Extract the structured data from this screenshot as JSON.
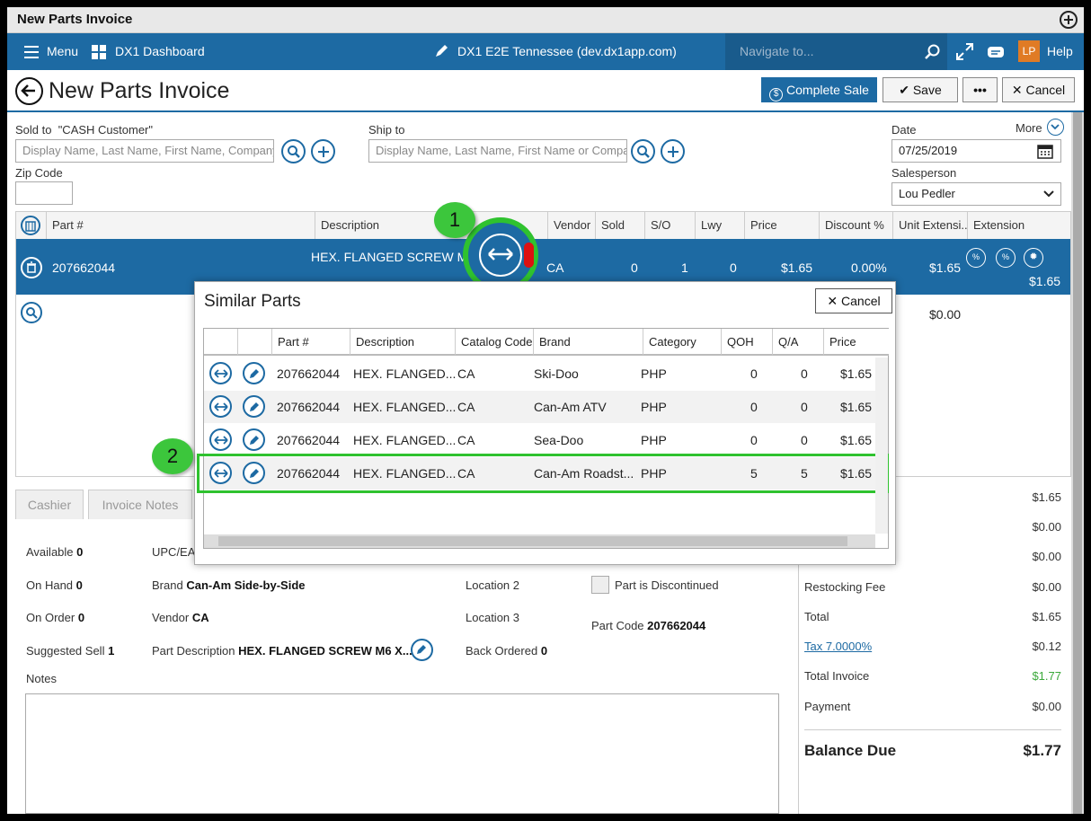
{
  "window": {
    "title": "New Parts Invoice"
  },
  "topnav": {
    "menu": "Menu",
    "dashboard": "DX1 Dashboard",
    "site": "DX1 E2E Tennessee (dev.dx1app.com)",
    "navigate_placeholder": "Navigate to...",
    "avatar": "LP",
    "help": "Help"
  },
  "header": {
    "title": "New Parts Invoice",
    "complete_sale": "Complete Sale",
    "save": "Save",
    "more_btn": "•••",
    "cancel": "Cancel"
  },
  "form": {
    "sold_to_label": "Sold to  \"CASH Customer\"",
    "sold_to_placeholder": "Display Name, Last Name, First Name, Company",
    "ship_to_label": "Ship to",
    "ship_to_placeholder": "Display Name, Last Name, First Name or Company",
    "zip_label": "Zip Code",
    "date_label": "Date",
    "date_value": "07/25/2019",
    "more": "More",
    "salesperson_label": "Salesperson",
    "salesperson_value": "Lou Pedler"
  },
  "grid": {
    "headers": [
      "Part #",
      "Description",
      "Vendor",
      "Sold",
      "S/O",
      "Lwy",
      "Price",
      "Discount %",
      "Unit Extensi...",
      "Extension"
    ],
    "row": {
      "part": "207662044",
      "description": "HEX. FLANGED SCREW M6",
      "vendor": "CA",
      "sold": "0",
      "so": "1",
      "lwy": "0",
      "price": "$1.65",
      "discount": "0.00%",
      "unit_ext": "$1.65",
      "extension": "$1.65"
    },
    "empty_row_total": "$0.00"
  },
  "tabs": [
    "Cashier",
    "Invoice Notes"
  ],
  "details": {
    "available_label": "Available",
    "available": "0",
    "on_hand_label": "On Hand",
    "on_hand": "0",
    "on_order_label": "On Order",
    "on_order": "0",
    "suggested_label": "Suggested Sell",
    "suggested": "1",
    "upc_label": "UPC/EAN",
    "brand_label": "Brand",
    "brand": "Can-Am Side-by-Side",
    "vendor_label": "Vendor",
    "vendor": "CA",
    "part_desc_label": "Part Description",
    "part_desc": "HEX. FLANGED SCREW M6 X...",
    "location2": "Location 2",
    "location3": "Location 3",
    "back_ordered_label": "Back Ordered",
    "back_ordered": "0",
    "discontinued": "Part is Discontinued",
    "part_code_label": "Part Code",
    "part_code": "207662044",
    "notes_label": "Notes"
  },
  "totals": {
    "row1": "$1.65",
    "row2": "$0.00",
    "row3": "$0.00",
    "restocking_label": "Restocking Fee",
    "restocking": "$0.00",
    "total_label": "Total",
    "total": "$1.65",
    "tax_label": "Tax 7.0000%",
    "tax": "$0.12",
    "total_invoice_label": "Total Invoice",
    "total_invoice": "$1.77",
    "payment_label": "Payment",
    "payment": "$0.00",
    "balance_label": "Balance Due",
    "balance": "$1.77"
  },
  "modal": {
    "title": "Similar Parts",
    "cancel": "Cancel",
    "headers": [
      "Part #",
      "Description",
      "Catalog Code",
      "Brand",
      "Category",
      "QOH",
      "Q/A",
      "Price"
    ],
    "rows": [
      {
        "part": "207662044",
        "description": "HEX. FLANGED...",
        "catalog": "CA",
        "brand": "Ski-Doo",
        "category": "PHP",
        "qoh": "0",
        "qa": "0",
        "price": "$1.65"
      },
      {
        "part": "207662044",
        "description": "HEX. FLANGED...",
        "catalog": "CA",
        "brand": "Can-Am ATV",
        "category": "PHP",
        "qoh": "0",
        "qa": "0",
        "price": "$1.65"
      },
      {
        "part": "207662044",
        "description": "HEX. FLANGED...",
        "catalog": "CA",
        "brand": "Sea-Doo",
        "category": "PHP",
        "qoh": "0",
        "qa": "0",
        "price": "$1.65"
      },
      {
        "part": "207662044",
        "description": "HEX. FLANGED...",
        "catalog": "CA",
        "brand": "Can-Am Roadst...",
        "category": "PHP",
        "qoh": "5",
        "qa": "5",
        "price": "$1.65"
      }
    ]
  },
  "callouts": {
    "one": "1",
    "two": "2"
  },
  "colors": {
    "primary": "#1d6aa3",
    "highlight": "#2fc22f",
    "total_green": "#3aa83a"
  }
}
